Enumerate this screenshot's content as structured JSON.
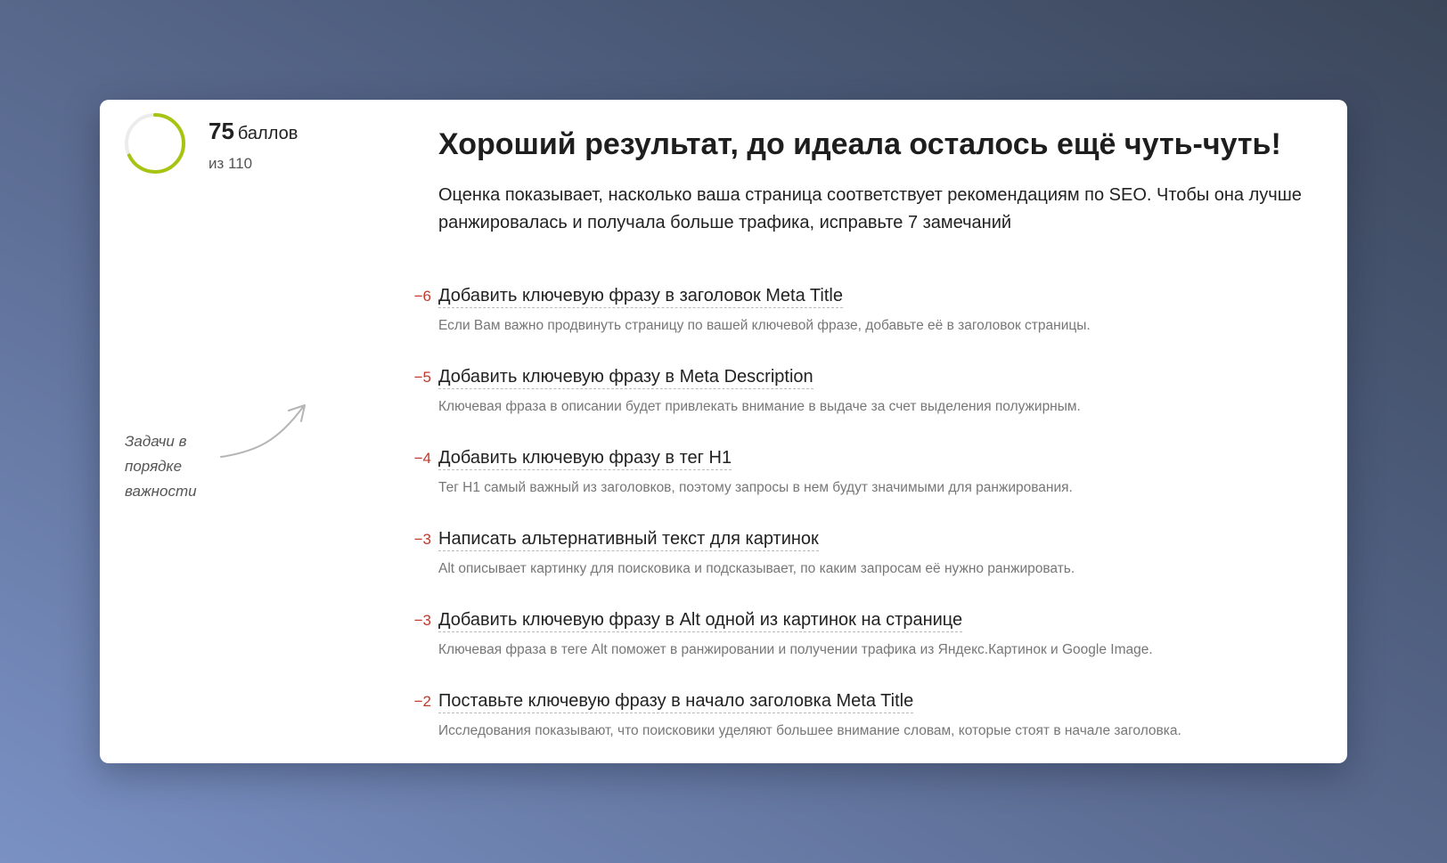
{
  "score": {
    "value": "75",
    "unit": "баллов",
    "max_label": "из 110",
    "fraction": 0.68,
    "ring_color": "#a8c412",
    "track_color": "#ececec"
  },
  "side_note": {
    "line1": "Задачи в",
    "line2": "порядке",
    "line3": "важности"
  },
  "headline": "Хороший результат, до идеала осталось ещё чуть-чуть!",
  "lead": "Оценка показывает, насколько ваша страница соответствует рекомендациям по SEO. Чтобы она лучше ранжировалась и получала больше трафика, исправьте 7 замечаний",
  "colors": {
    "penalty": "#c0392b",
    "accent": "#a8c412"
  },
  "tasks": [
    {
      "penalty": "−6",
      "title": "Добавить ключевую фразу в заголовок Meta Title",
      "desc": "Если Вам важно продвинуть страницу по вашей ключевой фразе, добавьте её в заголовок страницы."
    },
    {
      "penalty": "−5",
      "title": "Добавить ключевую фразу в Meta Description",
      "desc": "Ключевая фраза в описании будет привлекать внимание в выдаче за счет выделения полужирным."
    },
    {
      "penalty": "−4",
      "title": "Добавить ключевую фразу в тег H1",
      "desc": "Тег H1 самый важный из заголовков, поэтому запросы в нем будут значимыми для ранжирования."
    },
    {
      "penalty": "−3",
      "title": "Написать альтернативный текст для картинок",
      "desc": "Alt описывает картинку для поисковика и подсказывает, по каким запросам её нужно ранжировать."
    },
    {
      "penalty": "−3",
      "title": "Добавить ключевую фразу в Alt одной из картинок на странице",
      "desc": "Ключевая фраза в теге Alt поможет в ранжировании и получении трафика из Яндекс.Картинок и Google Image."
    },
    {
      "penalty": "−2",
      "title": "Поставьте ключевую фразу в начало заголовка Meta Title",
      "desc": "Исследования показывают, что поисковики уделяют большее внимание словам, которые стоят в начале заголовка."
    }
  ]
}
